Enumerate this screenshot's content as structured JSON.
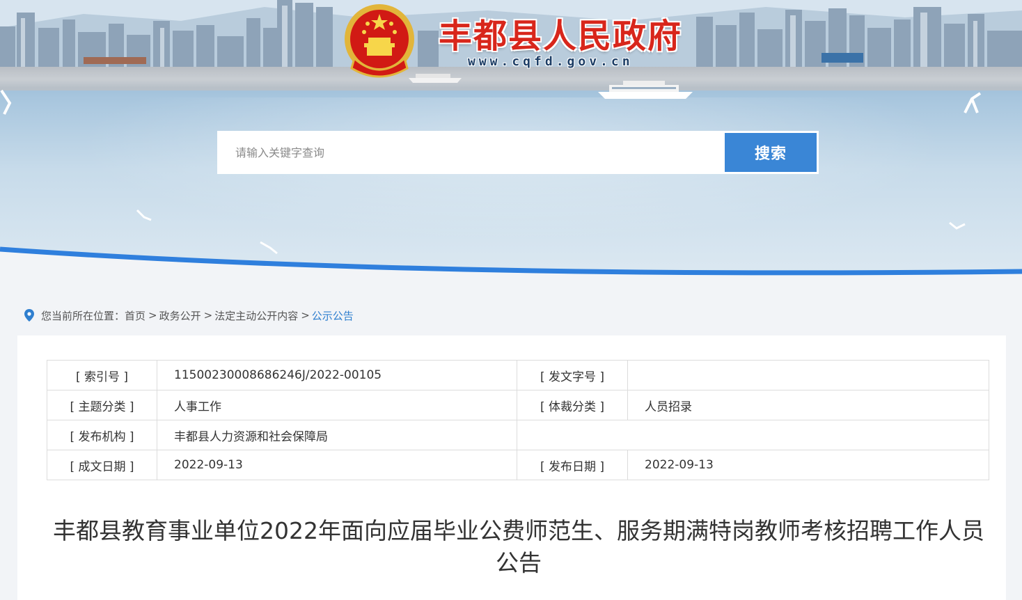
{
  "header": {
    "site_name": "丰都县人民政府",
    "site_url": "www.cqfd.gov.cn"
  },
  "search": {
    "placeholder": "请输入关键字查询",
    "button_label": "搜索"
  },
  "breadcrumb": {
    "prefix": "您当前所在位置：",
    "items": [
      "首页",
      "政务公开",
      "法定主动公开内容",
      "公示公告"
    ],
    "separator": ">"
  },
  "meta": {
    "index_no_label": "[ 索引号 ]",
    "index_no_value": "11500230008686246J/2022-00105",
    "doc_no_label": "[ 发文字号 ]",
    "doc_no_value": "",
    "topic_label": "[ 主题分类 ]",
    "topic_value": "人事工作",
    "genre_label": "[ 体裁分类 ]",
    "genre_value": "人员招录",
    "org_label": "[ 发布机构 ]",
    "org_value": "丰都县人力资源和社会保障局",
    "created_label": "[ 成文日期 ]",
    "created_value": "2022-09-13",
    "published_label": "[ 发布日期 ]",
    "published_value": "2022-09-13"
  },
  "article": {
    "title": "丰都县教育事业单位2022年面向应届毕业公费师范生、服务期满特岗教师考核招聘工作人员公告"
  },
  "colors": {
    "brand_red": "#d8261b",
    "accent_blue": "#3a86d6",
    "link_blue": "#2f7fcf"
  }
}
